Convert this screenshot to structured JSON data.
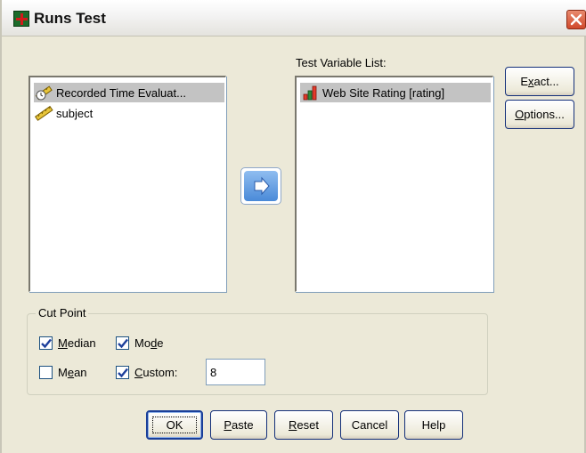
{
  "window": {
    "title": "Runs Test"
  },
  "source_list": {
    "items": [
      {
        "label": "Recorded Time Evaluat...",
        "icon": "scale-ruler-clock-icon",
        "selected": true
      },
      {
        "label": "subject",
        "icon": "scale-ruler-icon",
        "selected": false
      }
    ]
  },
  "target_list": {
    "label": "Test Variable List:",
    "items": [
      {
        "label": "Web Site Rating [rating]",
        "icon": "ordinal-bars-icon",
        "selected": true
      }
    ]
  },
  "buttons": {
    "exact_pre": "E",
    "exact_ul": "x",
    "exact_post": "act...",
    "options_ul": "O",
    "options_post": "ptions...",
    "ok": "OK",
    "paste_ul": "P",
    "paste_post": "aste",
    "reset_ul": "R",
    "reset_post": "eset",
    "cancel": "Cancel",
    "help": "Help"
  },
  "cut_point": {
    "legend": "Cut Point",
    "median_pre": "",
    "median_ul": "M",
    "median_post": "edian",
    "median_checked": true,
    "mode_pre": "Mo",
    "mode_ul": "d",
    "mode_post": "e",
    "mode_checked": true,
    "mean_pre": "M",
    "mean_ul": "e",
    "mean_post": "an",
    "mean_checked": false,
    "custom_pre": "",
    "custom_ul": "C",
    "custom_post": "ustom:",
    "custom_checked": true,
    "custom_value": "8"
  },
  "colors": {
    "dialog_bg": "#ece9d8",
    "selection": "#c3c3c3",
    "button_border": "#14307a",
    "checkmark": "#1d3f9b"
  }
}
